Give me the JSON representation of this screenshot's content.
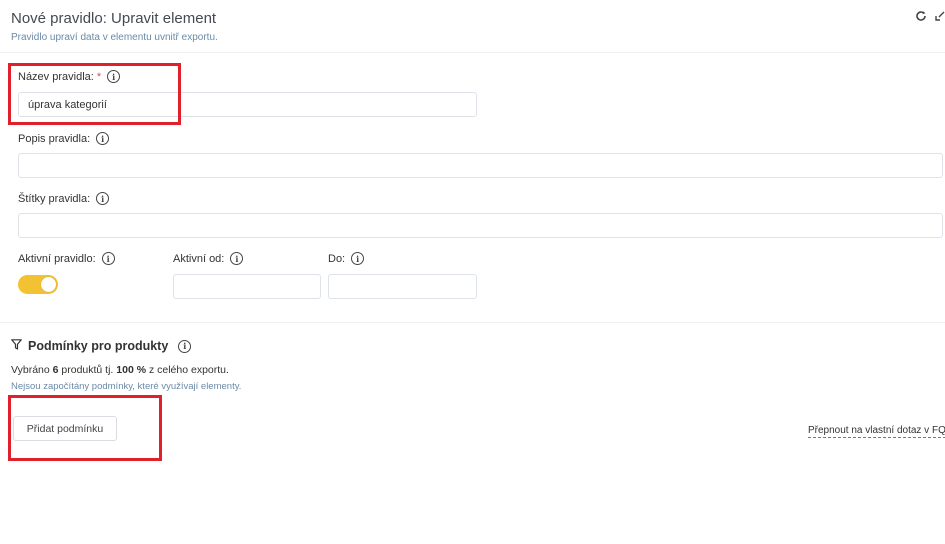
{
  "header": {
    "title": "Nové pravidlo: Upravit element",
    "subtitle": "Pravidlo upraví data v elementu uvnitř exportu.",
    "icons": [
      "refresh-icon",
      "collapse-icon"
    ]
  },
  "form": {
    "name": {
      "label": "Název pravidla:",
      "required_mark": "*",
      "value": "úprava kategorií"
    },
    "description": {
      "label": "Popis pravidla:",
      "value": ""
    },
    "tags": {
      "label": "Štítky pravidla:",
      "value": ""
    },
    "active": {
      "label": "Aktivní pravidlo:",
      "enabled": true
    },
    "active_from": {
      "label": "Aktivní od:",
      "value": ""
    },
    "active_to": {
      "label": "Do:",
      "value": ""
    }
  },
  "conditions": {
    "title": "Podmínky pro produkty",
    "stat_prefix": "Vybráno ",
    "stat_count": "6",
    "stat_mid": " produktů tj. ",
    "stat_percent": "100 %",
    "stat_suffix": " z celého exportu.",
    "note": "Nejsou započítány podmínky, které využívají elementy.",
    "add_button": "Přidat podmínku",
    "fql_link": "Přepnout na vlastní dotaz v FQL"
  },
  "colors": {
    "toggle_on": "#f2c233",
    "highlight": "#e0202a",
    "subtitle": "#6a8aa8"
  }
}
